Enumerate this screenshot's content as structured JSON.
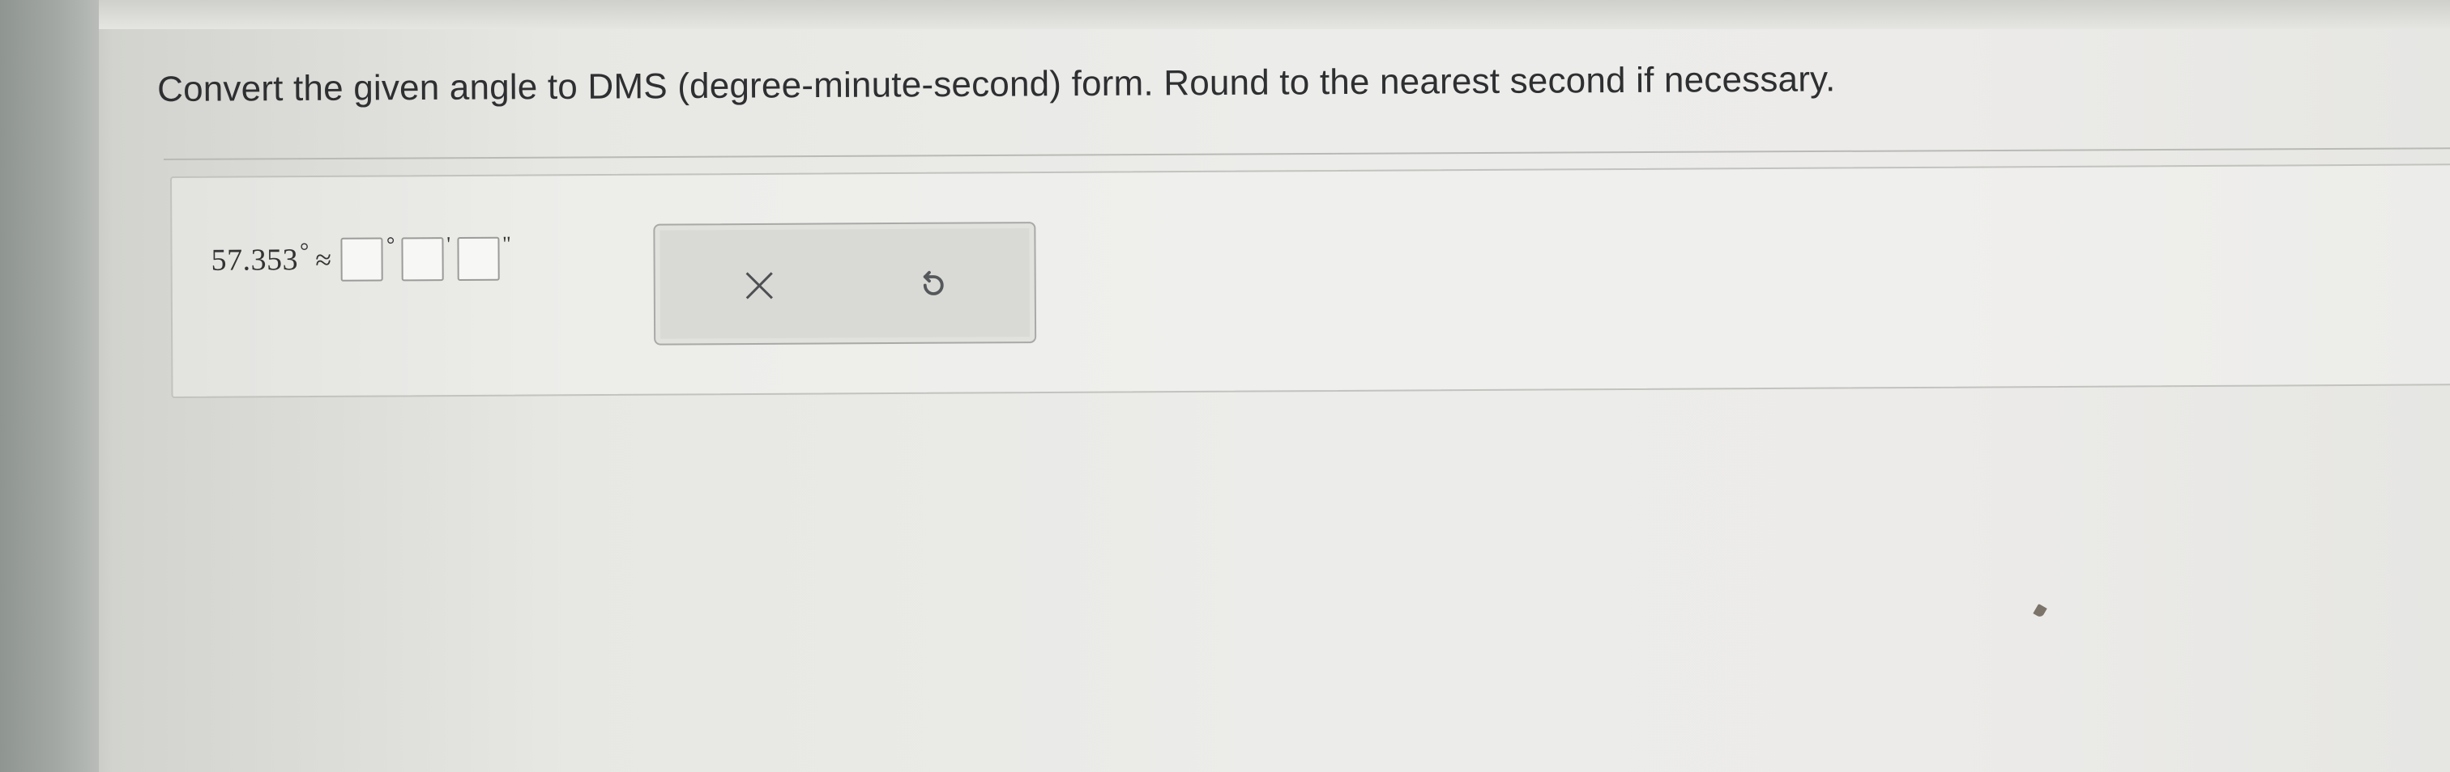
{
  "question": {
    "instruction": "Convert the given angle to DMS (degree-minute-second) form. Round to the nearest second if necessary."
  },
  "answer": {
    "angle_value": "57.353",
    "degree_symbol": "°",
    "approx_symbol": "≈",
    "degree_unit": "°",
    "minute_unit": "'",
    "second_unit": "\"",
    "degrees_value": "",
    "minutes_value": "",
    "seconds_value": ""
  },
  "actions": {
    "clear_icon": "close-icon",
    "undo_icon": "undo-icon"
  },
  "colors": {
    "text": "#2e2f31",
    "panel_border": "#c2c3bf",
    "action_box_bg": "#d9d9d6"
  }
}
